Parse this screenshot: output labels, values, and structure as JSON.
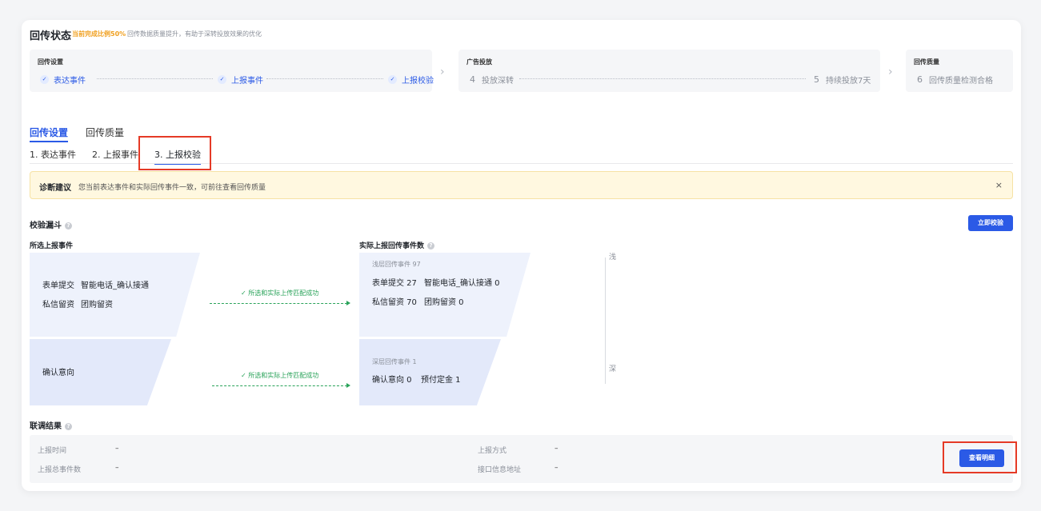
{
  "header": {
    "title": "回传状态",
    "completion": "当前完成比例50%",
    "description": "回传数据质量提升，有助于深转投放效果的优化"
  },
  "stages": [
    {
      "title": "回传设置",
      "steps": [
        {
          "label": "表达事件",
          "done": true
        },
        {
          "label": "上报事件",
          "done": true
        },
        {
          "label": "上报校验",
          "done": true
        }
      ]
    },
    {
      "title": "广告投放",
      "steps": [
        {
          "num": "4",
          "label": "投放深转",
          "done": false
        },
        {
          "num": "5",
          "label": "持续投放7天",
          "done": false
        }
      ]
    },
    {
      "title": "回传质量",
      "steps": [
        {
          "num": "6",
          "label": "回传质量检测合格",
          "done": false
        }
      ]
    }
  ],
  "main_tabs": [
    {
      "label": "回传设置",
      "active": true
    },
    {
      "label": "回传质量",
      "active": false
    }
  ],
  "sub_tabs": [
    {
      "label": "1. 表达事件"
    },
    {
      "label": "2. 上报事件"
    },
    {
      "label": "3. 上报校验",
      "active": true
    }
  ],
  "notice": {
    "title": "诊断建议",
    "text": "您当前表达事件和实际回传事件一致，可前往查看回传质量",
    "close": "×"
  },
  "funnel": {
    "title": "校验漏斗",
    "verify_button": "立即校验",
    "left_title": "所选上报事件",
    "right_title": "实际上报回传事件数",
    "shallow_left": [
      [
        "表单提交",
        "智能电话_确认接通"
      ],
      [
        "私信留资",
        "团购留资"
      ]
    ],
    "deep_left": [
      "确认意向"
    ],
    "match_label": "所选和实际上传匹配成功",
    "shallow_right": {
      "header": "浅层回传事件 97",
      "rows": [
        [
          "表单提交 27",
          "智能电话_确认接通 0"
        ],
        [
          "私信留资 70",
          "团购留资 0"
        ]
      ]
    },
    "deep_right": {
      "header": "深层回传事件 1",
      "rows": [
        [
          "确认意向 0",
          "预付定金 1"
        ]
      ]
    },
    "axis_top": "浅",
    "axis_bottom": "深"
  },
  "result": {
    "title": "联调结果",
    "report_time_label": "上报时间",
    "report_time_value": "–",
    "report_count_label": "上报总事件数",
    "report_count_value": "–",
    "report_method_label": "上报方式",
    "report_method_value": "–",
    "api_address_label": "接口信息地址",
    "api_address_value": "–",
    "detail_button": "查看明细"
  },
  "colors": {
    "primary": "#2b5ae6",
    "warning": "#f0a020",
    "success": "#2aa35a",
    "highlight": "#e53a26"
  }
}
